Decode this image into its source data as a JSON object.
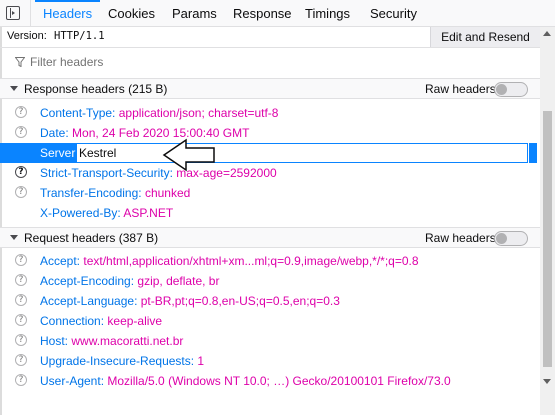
{
  "tabs": [
    {
      "label": "Headers",
      "active": true
    },
    {
      "label": "Cookies"
    },
    {
      "label": "Params"
    },
    {
      "label": "Response"
    },
    {
      "label": "Timings"
    },
    {
      "label": "Security"
    }
  ],
  "version": {
    "label": "Version:",
    "value": "HTTP/1.1"
  },
  "resend_label": "Edit and Resend",
  "filter": {
    "placeholder": "Filter headers"
  },
  "response_section": {
    "title": "Response headers (215 B)",
    "raw_label": "Raw headers",
    "raw_enabled": false,
    "headers": [
      {
        "name": "Content-Type:",
        "value": "application/json; charset=utf-8"
      },
      {
        "name": "Date:",
        "value": "Mon, 24 Feb 2020 15:00:40 GMT"
      },
      {
        "name": "Server:",
        "value": "Kestrel"
      },
      {
        "name": "Strict-Transport-Security:",
        "value": "max-age=2592000"
      },
      {
        "name": "Transfer-Encoding:",
        "value": "chunked"
      },
      {
        "name": "X-Powered-By:",
        "value": "ASP.NET"
      }
    ]
  },
  "request_section": {
    "title": "Request headers (387 B)",
    "raw_label": "Raw headers",
    "raw_enabled": false,
    "headers": [
      {
        "name": "Accept:",
        "value": "text/html,application/xhtml+xm...ml;q=0.9,image/webp,*/*;q=0.8"
      },
      {
        "name": "Accept-Encoding:",
        "value": "gzip, deflate, br"
      },
      {
        "name": "Accept-Language:",
        "value": "pt-BR,pt;q=0.8,en-US;q=0.5,en;q=0.3"
      },
      {
        "name": "Connection:",
        "value": "keep-alive"
      },
      {
        "name": "Host:",
        "value": "www.macoratti.net.br"
      },
      {
        "name": "Upgrade-Insecure-Requests:",
        "value": "1"
      },
      {
        "name": "User-Agent:",
        "value": "Mozilla/5.0 (Windows NT 10.0; …) Gecko/20100101 Firefox/73.0"
      }
    ]
  },
  "help_glyph": "?",
  "colors": {
    "accent": "#0a84ff",
    "header_name": "#0074e8",
    "header_value": "#dd00a9"
  }
}
